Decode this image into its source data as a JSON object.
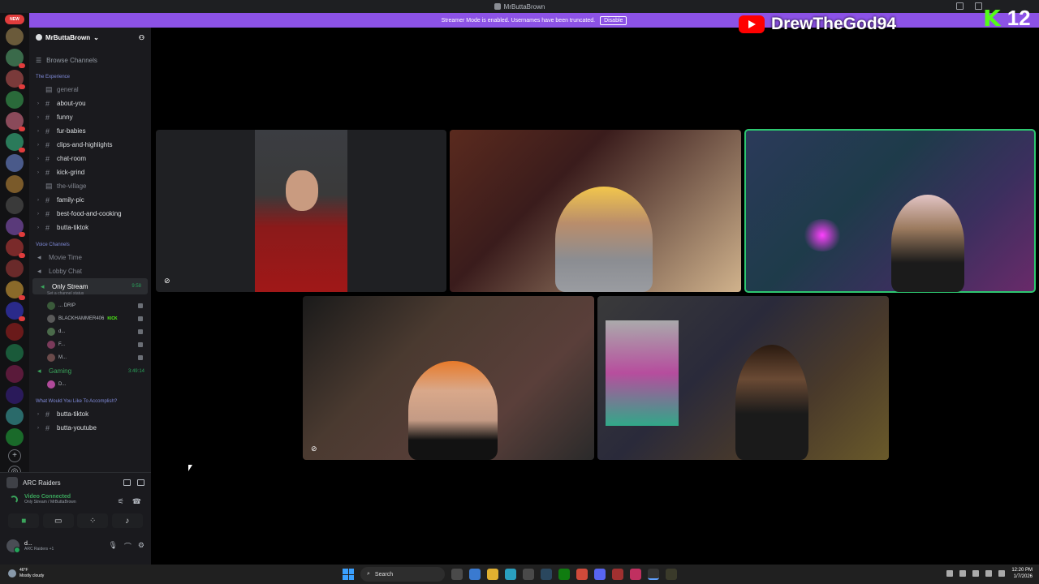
{
  "window": {
    "title": "MrButtaBrown"
  },
  "banner": {
    "text": "Streamer Mode is enabled. Usernames have been truncated.",
    "disable_label": "Disable"
  },
  "rail": {
    "new_badge": "NEW"
  },
  "sidebar": {
    "server_name": "MrButtaBrown",
    "browse_label": "Browse Channels",
    "categories": {
      "experience": "The Experience",
      "voice": "Voice Channels",
      "accomplish": "What Would You Like To Accomplish?"
    },
    "text_channels": [
      {
        "name": "general",
        "muted": true
      },
      {
        "name": "about-you",
        "muted": false
      },
      {
        "name": "funny",
        "muted": false
      },
      {
        "name": "fur-babies",
        "muted": false
      },
      {
        "name": "clips-and-highlights",
        "muted": false
      },
      {
        "name": "chat-room",
        "muted": false
      },
      {
        "name": "kick-grind",
        "muted": false
      },
      {
        "name": "the-village",
        "muted": true
      },
      {
        "name": "family-pic",
        "muted": false
      },
      {
        "name": "best-food-and-cooking",
        "muted": false
      },
      {
        "name": "butta-tiktok",
        "muted": false
      }
    ],
    "voice_channels": {
      "movie_time": "Movie Time",
      "lobby_chat": "Lobby Chat",
      "only_stream": "Only Stream",
      "only_stream_time": "9:58",
      "only_stream_status": "Set a channel status",
      "members": [
        {
          "name": "... DRIP"
        },
        {
          "name": "BLACKHAMMER406",
          "badge": "KICK"
        },
        {
          "name": "d..."
        },
        {
          "name": "F..."
        },
        {
          "name": "M..."
        }
      ],
      "gaming": "Gaming",
      "gaming_time": "3:49:14",
      "gaming_members": [
        {
          "name": "D..."
        }
      ]
    },
    "accomplish_channels": [
      "butta-tiktok",
      "butta-youtube"
    ]
  },
  "voice_panel": {
    "game": "ARC Raiders",
    "connection": "Video Connected",
    "connection_sub": "Only Stream / MrButtaBrown",
    "user_name": "d...",
    "user_status": "ARC Raiders +1"
  },
  "overlay": {
    "youtube_name": "DrewTheGod94",
    "kick_count": "12"
  },
  "taskbar": {
    "weather_temp": "46°F",
    "weather_desc": "Mostly cloudy",
    "search_label": "Search",
    "time": "12:20 PM",
    "date": "1/7/2026"
  }
}
